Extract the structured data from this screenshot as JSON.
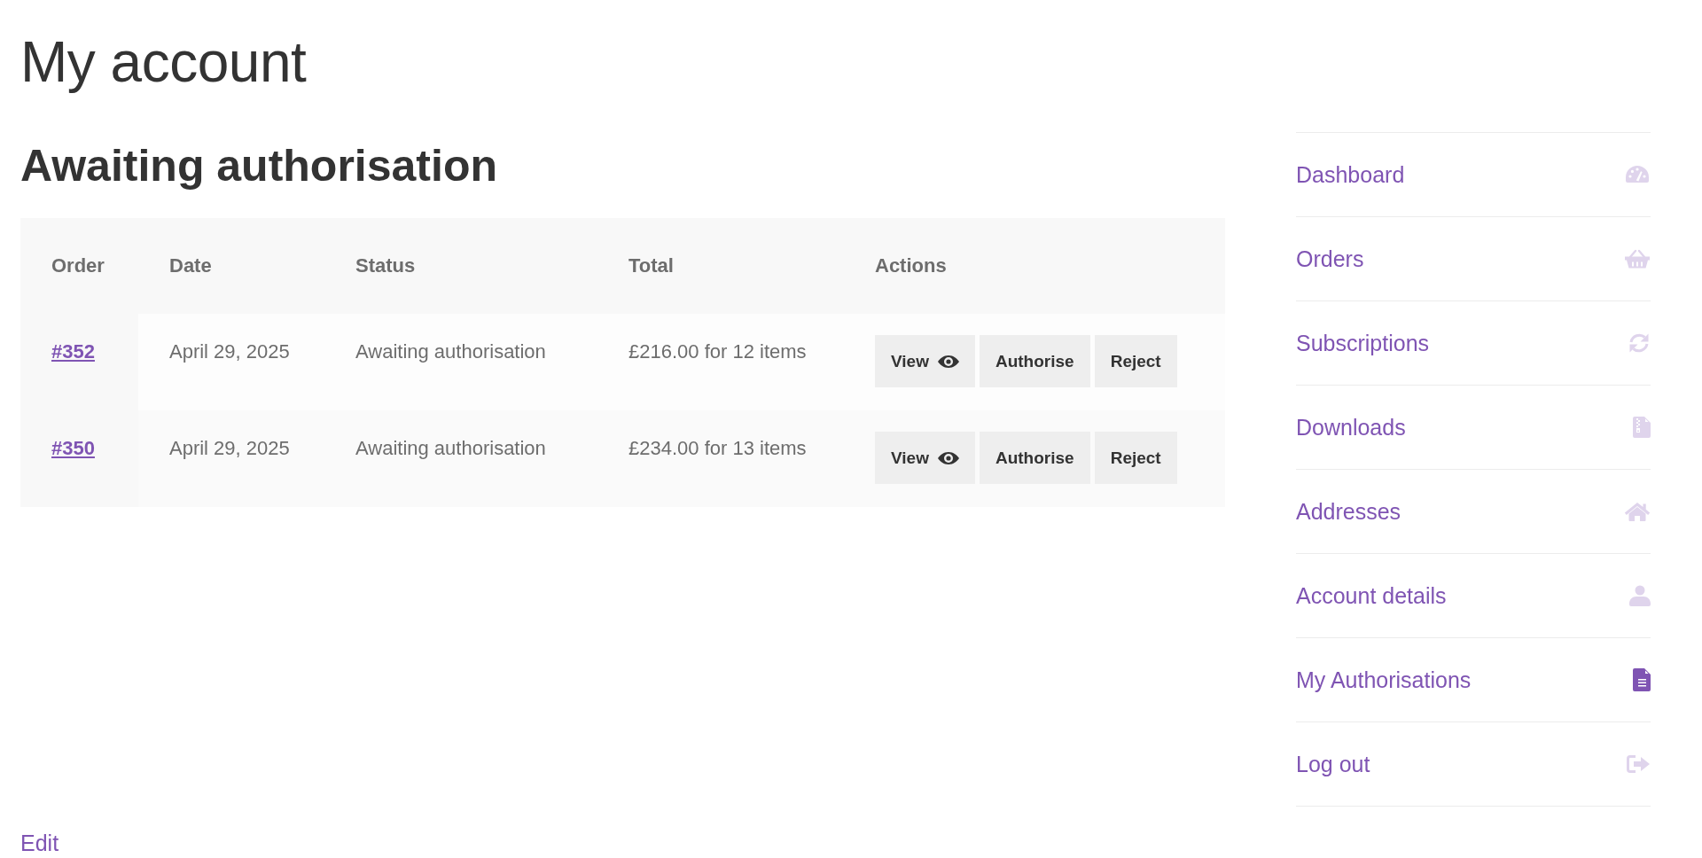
{
  "page": {
    "title": "My account"
  },
  "main": {
    "heading": "Awaiting authorisation",
    "table": {
      "columns": [
        "Order",
        "Date",
        "Status",
        "Total",
        "Actions"
      ],
      "rows": [
        {
          "order": "#352",
          "date": "April 29, 2025",
          "status": "Awaiting authorisation",
          "total": "£216.00 for 12 items",
          "actions": [
            {
              "label": "View",
              "kind": "view"
            },
            {
              "label": "Authorise",
              "kind": "plain"
            },
            {
              "label": "Reject",
              "kind": "plain"
            }
          ]
        },
        {
          "order": "#350",
          "date": "April 29, 2025",
          "status": "Awaiting authorisation",
          "total": "£234.00 for 13 items",
          "actions": [
            {
              "label": "View",
              "kind": "view"
            },
            {
              "label": "Authorise",
              "kind": "plain"
            },
            {
              "label": "Reject",
              "kind": "plain"
            }
          ]
        }
      ]
    }
  },
  "sidebar": {
    "items": [
      {
        "label": "Dashboard",
        "selected": false
      },
      {
        "label": "Orders",
        "selected": false
      },
      {
        "label": "Subscriptions",
        "selected": false
      },
      {
        "label": "Downloads",
        "selected": false
      },
      {
        "label": "Addresses",
        "selected": false
      },
      {
        "label": "Account details",
        "selected": false
      },
      {
        "label": "My Authorisations",
        "selected": true
      },
      {
        "label": "Log out",
        "selected": false
      }
    ]
  },
  "edit_link": "Edit"
}
